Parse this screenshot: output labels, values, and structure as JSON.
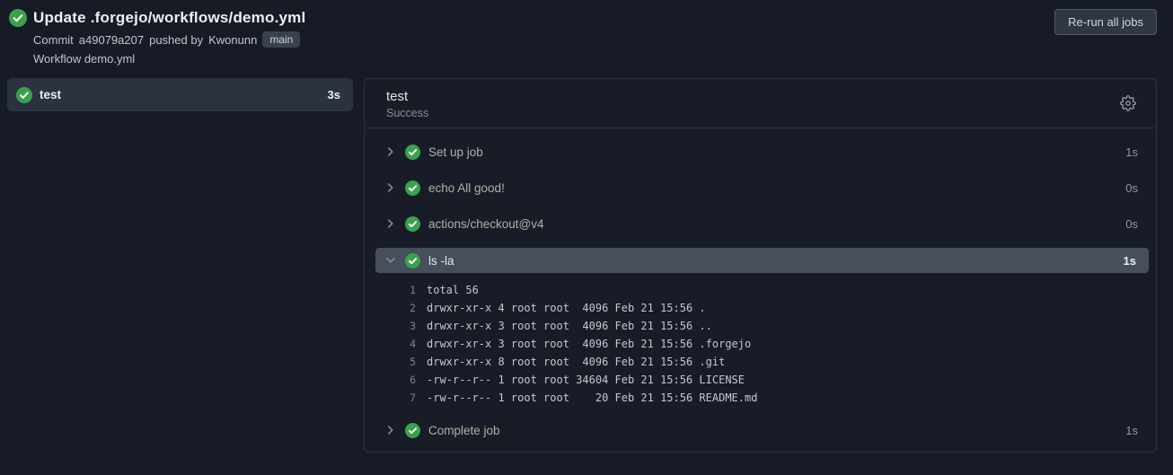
{
  "header": {
    "title": "Update .forgejo/workflows/demo.yml",
    "commit_prefix": "Commit",
    "commit_sha": "a49079a207",
    "commit_middle": "pushed by",
    "commit_user": "Kwonunn",
    "branch_badge": "main",
    "workflow_line": "Workflow demo.yml",
    "rerun_button": "Re-run all jobs"
  },
  "sidebar": {
    "jobs": [
      {
        "name": "test",
        "duration": "3s",
        "status": "success"
      }
    ]
  },
  "job_panel": {
    "title": "test",
    "status": "Success",
    "steps": [
      {
        "name": "Set up job",
        "duration": "1s",
        "expanded": false
      },
      {
        "name": "echo All good!",
        "duration": "0s",
        "expanded": false
      },
      {
        "name": "actions/checkout@v4",
        "duration": "0s",
        "expanded": false
      },
      {
        "name": "ls -la",
        "duration": "1s",
        "expanded": true
      },
      {
        "name": "Complete job",
        "duration": "1s",
        "expanded": false
      }
    ],
    "log": {
      "lines": [
        {
          "num": "1",
          "text": "total 56"
        },
        {
          "num": "2",
          "text": "drwxr-xr-x 4 root root  4096 Feb 21 15:56 ."
        },
        {
          "num": "3",
          "text": "drwxr-xr-x 3 root root  4096 Feb 21 15:56 .."
        },
        {
          "num": "4",
          "text": "drwxr-xr-x 3 root root  4096 Feb 21 15:56 .forgejo"
        },
        {
          "num": "5",
          "text": "drwxr-xr-x 8 root root  4096 Feb 21 15:56 .git"
        },
        {
          "num": "6",
          "text": "-rw-r--r-- 1 root root 34604 Feb 21 15:56 LICENSE"
        },
        {
          "num": "7",
          "text": "-rw-r--r-- 1 root root    20 Feb 21 15:56 README.md"
        }
      ]
    }
  },
  "colors": {
    "page_background": "#161b26",
    "panel_border": "#2d333f",
    "selected_job_background": "#2b3340",
    "expanded_step_background": "#474e5c",
    "success_green": "#3aa14d",
    "step_name_text": "#a9b5a5",
    "muted_text": "#8b929d"
  },
  "icons": {
    "status": "check-circle-icon",
    "settings": "gear-icon",
    "collapsed": "chevron-right-icon",
    "expanded": "chevron-down-icon"
  }
}
